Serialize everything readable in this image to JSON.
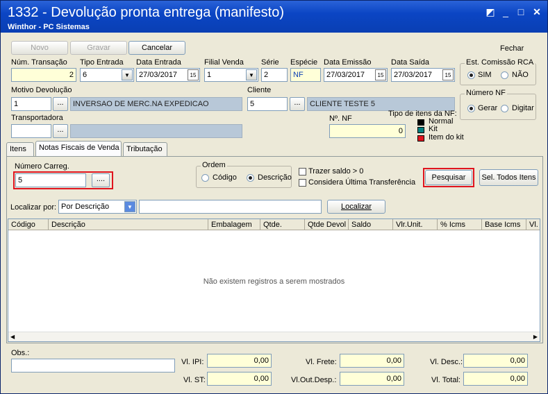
{
  "window": {
    "title": "1332 - Devolução pronta entrega (manifesto)",
    "subtitle": "Winthor - PC Sistemas"
  },
  "toolbar": {
    "novo": "Novo",
    "gravar": "Gravar",
    "cancelar": "Cancelar",
    "fechar": "Fechar"
  },
  "header": {
    "num_transacao": {
      "label": "Núm. Transação",
      "value": "2"
    },
    "tipo_entrada": {
      "label": "Tipo Entrada",
      "value": "6"
    },
    "data_entrada": {
      "label": "Data Entrada",
      "value": "27/03/2017"
    },
    "filial_venda": {
      "label": "Filial Venda",
      "value": "1"
    },
    "serie": {
      "label": "Série",
      "value": "2"
    },
    "especie": {
      "label": "Espécie",
      "value": "NF"
    },
    "data_emissao": {
      "label": "Data Emissão",
      "value": "27/03/2017"
    },
    "data_saida": {
      "label": "Data Saída",
      "value": "27/03/2017"
    },
    "motivo": {
      "label": "Motivo Devolução",
      "code": "1",
      "desc": "INVERSAO DE MERC.NA EXPEDICAO"
    },
    "cliente": {
      "label": "Cliente",
      "code": "5",
      "desc": "CLIENTE TESTE 5"
    },
    "transportadora": {
      "label": "Transportadora",
      "code": "",
      "desc": ""
    },
    "num_nf": {
      "label": "Nº. NF",
      "value": "0"
    }
  },
  "comissao": {
    "title": "Est. Comissão RCA",
    "sim": "SIM",
    "nao": "NÃO"
  },
  "numero_nf_group": {
    "title": "Número NF",
    "gerar": "Gerar",
    "digitar": "Digitar"
  },
  "tipo_itens": {
    "title": "Tipo de itens da NF:",
    "normal": "Normal",
    "kit": "Kit",
    "item_kit": "Item do kit",
    "colors": {
      "normal": "#000000",
      "kit": "#008080",
      "item_kit": "#e0141e"
    }
  },
  "tabs": [
    "Itens",
    "Notas Fiscais de Venda",
    "Tributação"
  ],
  "panel": {
    "numero_carreg": {
      "label": "Número Carreg.",
      "value": "5",
      "btn": "...."
    },
    "ordem": {
      "title": "Ordem",
      "codigo": "Código",
      "descricao": "Descrição"
    },
    "trazer_saldo": "Trazer saldo > 0",
    "considera": "Considera Última Transferência",
    "pesquisar": "Pesquisar",
    "sel_todos": "Sel. Todos Itens",
    "localizar_por": "Localizar por:",
    "localizar_opcao": "Por Descrição",
    "localizar_btn": "Localizar"
  },
  "grid": {
    "columns": [
      "Código",
      "Descrição",
      "Embalagem",
      "Qtde.",
      "Qtde Devol",
      "Saldo",
      "Vlr.Unit.",
      "% Icms",
      "Base Icms",
      "Vl."
    ],
    "empty": "Não existem registros a serem mostrados"
  },
  "footer": {
    "obs": "Obs.:",
    "vl_ipi": {
      "label": "Vl. IPI:",
      "value": "0,00"
    },
    "vl_st": {
      "label": "Vl. ST:",
      "value": "0,00"
    },
    "vl_frete": {
      "label": "Vl. Frete:",
      "value": "0,00"
    },
    "vl_out": {
      "label": "Vl.Out.Desp.:",
      "value": "0,00"
    },
    "vl_desc": {
      "label": "Vl. Desc.:",
      "value": "0,00"
    },
    "vl_total": {
      "label": "Vl. Total:",
      "value": "0,00"
    }
  }
}
